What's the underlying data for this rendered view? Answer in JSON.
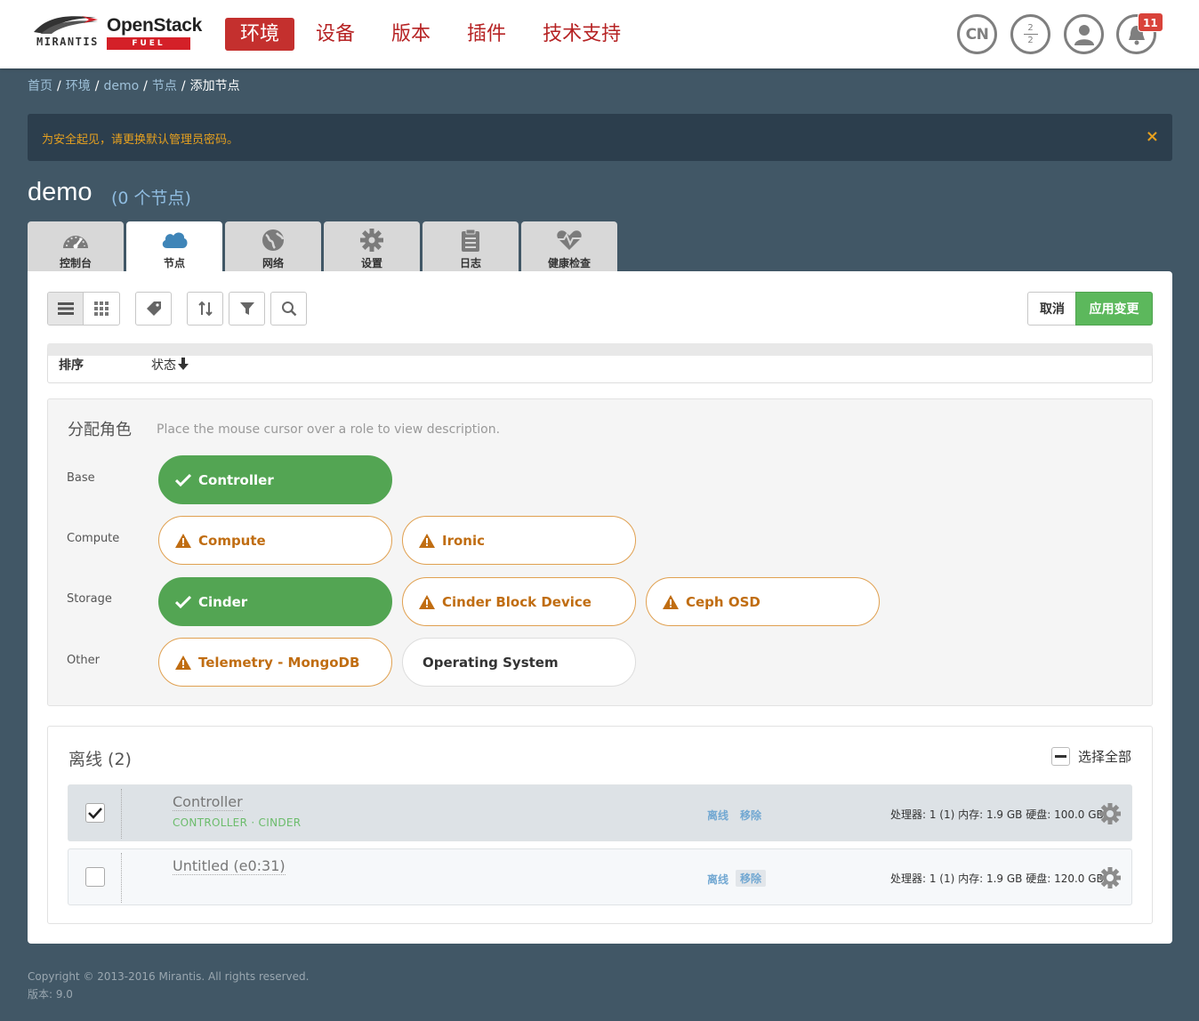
{
  "brand": {
    "mirantis": "MIRANTIS",
    "openstack": "OpenStack",
    "fuel": "FUEL",
    "accent_color": "#c4302e"
  },
  "nav": {
    "items": [
      {
        "label": "环境",
        "active": true
      },
      {
        "label": "设备",
        "active": false
      },
      {
        "label": "版本",
        "active": false
      },
      {
        "label": "插件",
        "active": false
      },
      {
        "label": "技术支持",
        "active": false
      }
    ]
  },
  "header_icons": {
    "language": "CN",
    "stats_top": "2",
    "stats_bottom": "2",
    "user_icon": "user-icon",
    "bell_icon": "bell-icon",
    "notification_count": "11"
  },
  "breadcrumb": {
    "items": [
      "首页",
      "环境",
      "demo",
      "节点"
    ],
    "current": "添加节点",
    "separator": "/"
  },
  "alert": {
    "text": "为安全起见，请更换默认管理员密码。",
    "close": "×",
    "text_color": "#e6a01f"
  },
  "environment": {
    "name": "demo",
    "node_count": "(0 个节点)"
  },
  "tabs": [
    {
      "label": "控制台",
      "icon": "dashboard-gauge-icon",
      "active": false
    },
    {
      "label": "节点",
      "icon": "cloud-icon",
      "active": true
    },
    {
      "label": "网络",
      "icon": "globe-icon",
      "active": false
    },
    {
      "label": "设置",
      "icon": "gear-icon",
      "active": false
    },
    {
      "label": "日志",
      "icon": "clipboard-icon",
      "active": false
    },
    {
      "label": "健康检查",
      "icon": "heartbeat-icon",
      "active": false
    }
  ],
  "toolbar": {
    "cancel_label": "取消",
    "apply_label": "应用变更",
    "apply_color": "#5cb85c"
  },
  "sort": {
    "label": "排序",
    "key": "状态"
  },
  "roles_panel": {
    "title": "分配角色",
    "hint": "Place the mouse cursor over a role to view description.",
    "categories": [
      {
        "name": "Base",
        "roles": [
          {
            "label": "Controller",
            "state": "selected"
          }
        ]
      },
      {
        "name": "Compute",
        "roles": [
          {
            "label": "Compute",
            "state": "warning"
          },
          {
            "label": "Ironic",
            "state": "warning"
          }
        ]
      },
      {
        "name": "Storage",
        "roles": [
          {
            "label": "Cinder",
            "state": "selected"
          },
          {
            "label": "Cinder Block Device",
            "state": "warning"
          },
          {
            "label": "Ceph OSD",
            "state": "warning"
          }
        ]
      },
      {
        "name": "Other",
        "roles": [
          {
            "label": "Telemetry - MongoDB",
            "state": "warning"
          },
          {
            "label": "Operating System",
            "state": "neutral"
          }
        ]
      }
    ]
  },
  "nodes_panel": {
    "group_title": "离线 (2)",
    "select_all": "选择全部",
    "nodes": [
      {
        "name": "Controller",
        "roles": "CONTROLLER · CINDER",
        "status": "离线",
        "remove": "移除",
        "specs": "处理器: 1 (1) 内存: 1.9 GB 硬盘: 100.0 GB",
        "checked": true
      },
      {
        "name": "Untitled (e0:31)",
        "roles": "",
        "status": "离线",
        "remove": "移除",
        "specs": "处理器: 1 (1) 内存: 1.9 GB 硬盘: 120.0 GB",
        "checked": false
      }
    ]
  },
  "footer": {
    "copyright": "Copyright © 2013-2016 Mirantis. All rights reserved.",
    "version": "版本: 9.0"
  }
}
